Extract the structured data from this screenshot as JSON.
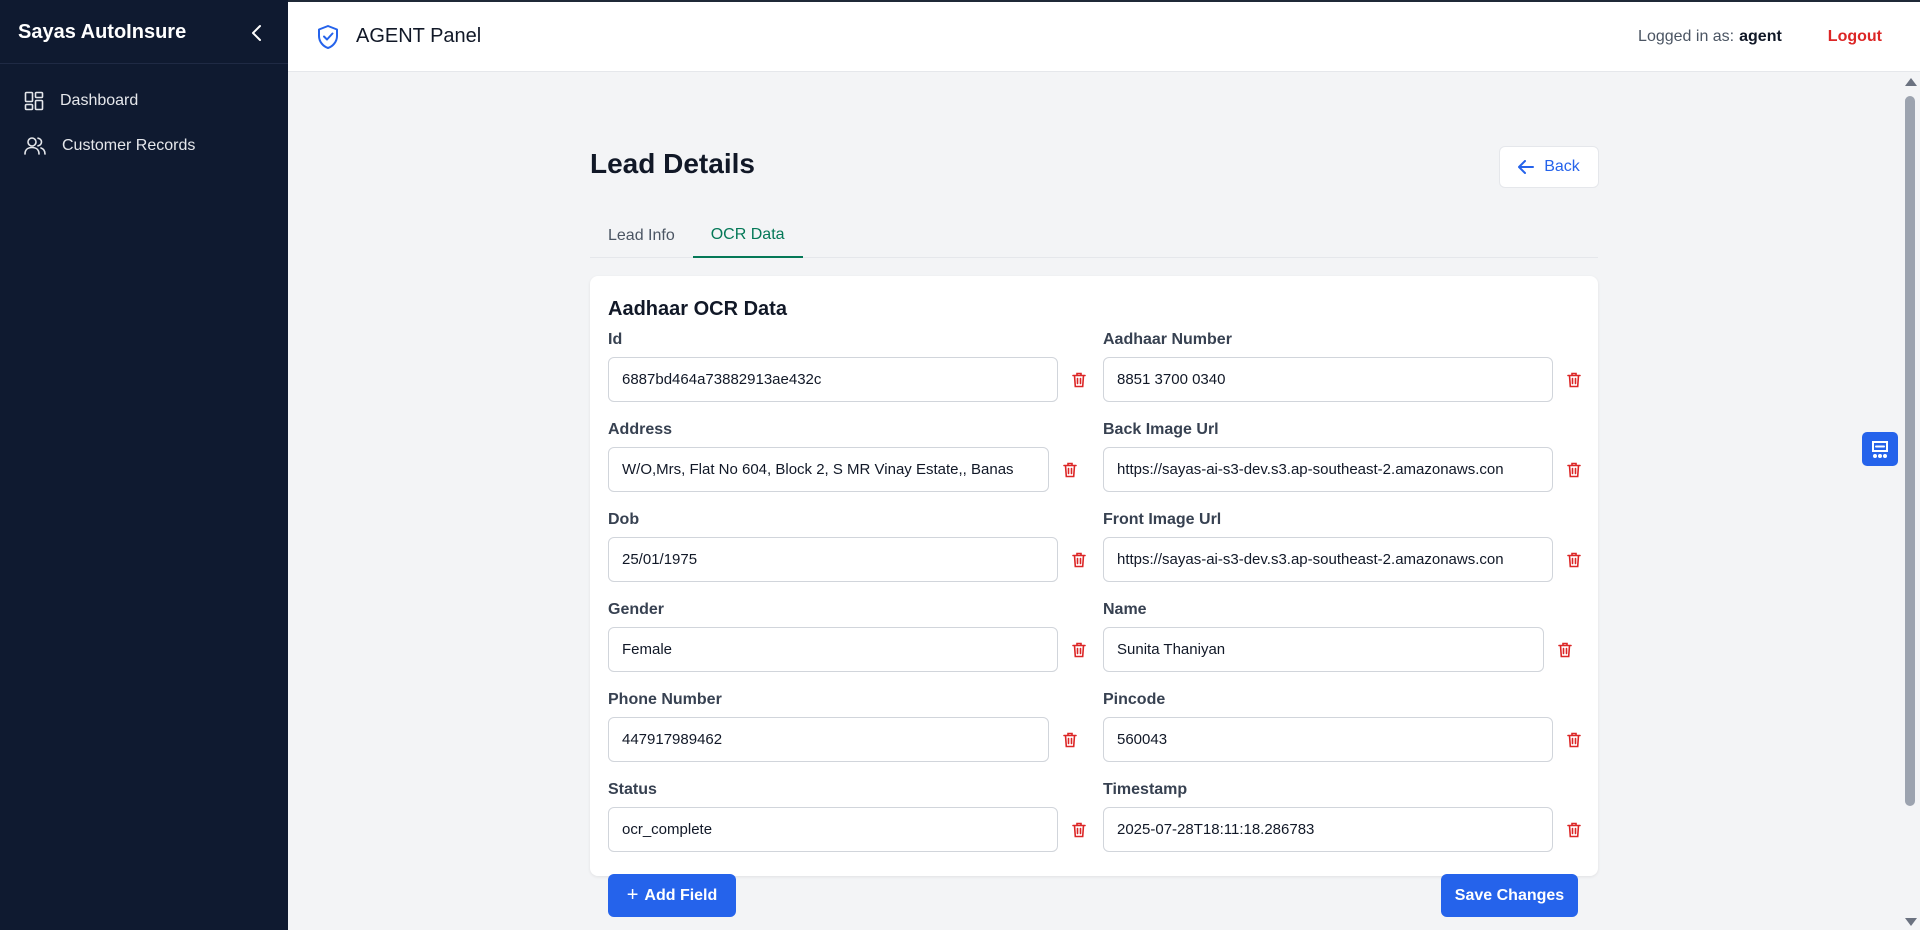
{
  "sidebar": {
    "brand": "Sayas AutoInsure",
    "items": [
      {
        "label": "Dashboard",
        "icon": "dashboard-icon"
      },
      {
        "label": "Customer Records",
        "icon": "users-icon"
      }
    ]
  },
  "header": {
    "title": "AGENT Panel",
    "logged_in_prefix": "Logged in as:",
    "user": "agent",
    "logout_label": "Logout"
  },
  "page": {
    "title": "Lead Details",
    "back_label": "Back",
    "tabs": [
      {
        "label": "Lead Info",
        "active": false
      },
      {
        "label": "OCR Data",
        "active": true
      }
    ]
  },
  "ocr": {
    "section_title": "Aadhaar OCR Data",
    "fields": [
      {
        "label": "Id",
        "value": "6887bd464a73882913ae432c"
      },
      {
        "label": "Aadhaar Number",
        "value": "8851 3700 0340"
      },
      {
        "label": "Address",
        "value": "W/O,Mrs, Flat No 604, Block 2, S MR Vinay Estate,, Banas"
      },
      {
        "label": "Back Image Url",
        "value": "https://sayas-ai-s3-dev.s3.ap-southeast-2.amazonaws.con"
      },
      {
        "label": "Dob",
        "value": "25/01/1975"
      },
      {
        "label": "Front Image Url",
        "value": "https://sayas-ai-s3-dev.s3.ap-southeast-2.amazonaws.con"
      },
      {
        "label": "Gender",
        "value": "Female"
      },
      {
        "label": "Name",
        "value": "Sunita Thaniyan"
      },
      {
        "label": "Phone Number",
        "value": "447917989462"
      },
      {
        "label": "Pincode",
        "value": "560043"
      },
      {
        "label": "Status",
        "value": "ocr_complete"
      },
      {
        "label": "Timestamp",
        "value": "2025-07-28T18:11:18.286783"
      }
    ],
    "add_field_label": "Add Field",
    "save_label": "Save Changes"
  },
  "colors": {
    "sidebar_bg": "#0f1a30",
    "primary": "#2563eb",
    "active_tab": "#047857",
    "danger": "#dc2626"
  }
}
